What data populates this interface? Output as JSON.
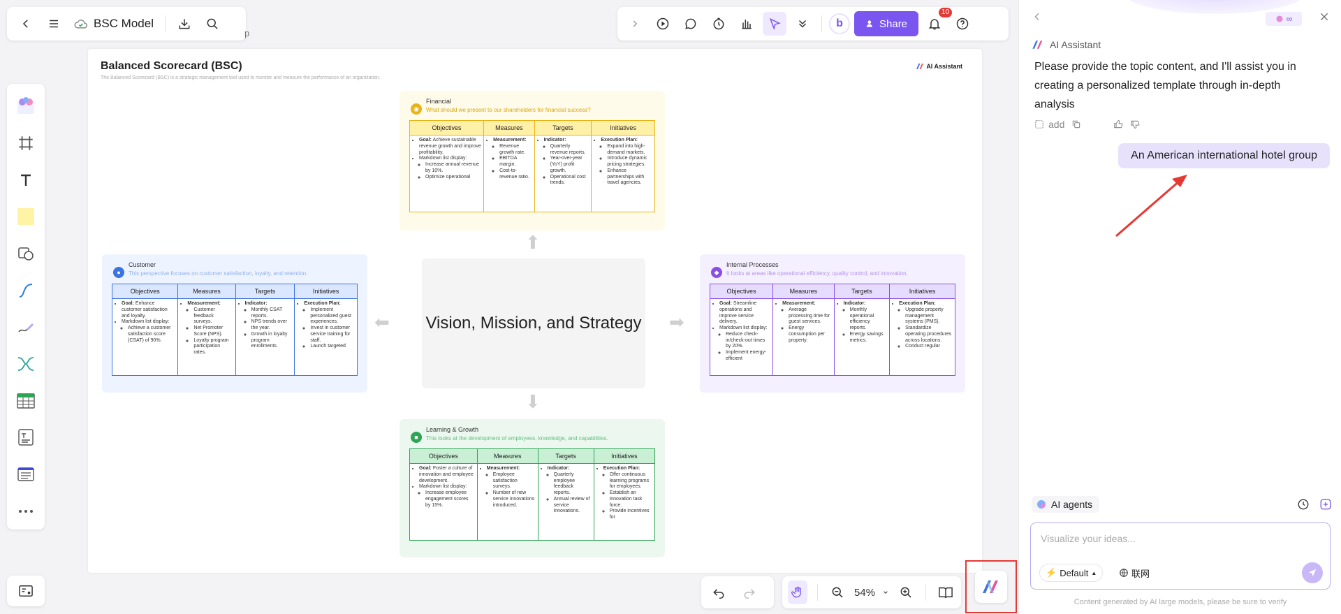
{
  "header": {
    "title": "BSC Model",
    "hidden_text": "p"
  },
  "toolbar": {
    "share_label": "Share",
    "notification_count": "10",
    "avatar_letter": "b"
  },
  "canvas": {
    "title": "Balanced Scorecard (BSC)",
    "subtitle": "The Balanced Scorecard (BSC) is a strategic management tool used to monitor and measure the performance of an organization.",
    "tag": "AI Assistant",
    "center": "Vision, Mission, and Strategy",
    "columns": [
      "Objectives",
      "Measures",
      "Targets",
      "Initiatives"
    ],
    "financial": {
      "title": "Financial",
      "subtitle": "What should we present to our shareholders for financial success?",
      "obj_goal_label": "Goal:",
      "obj_goal": "Achieve sustainable revenue growth and improve profitability.",
      "obj_md": "Markdown list display:",
      "obj_sub1": "Increase annual revenue by 10%.",
      "obj_sub2": "Optimize operational",
      "mea_label": "Measurement:",
      "mea1": "Revenue growth rate.",
      "mea2": "EBITDA margin.",
      "mea3": "Cost-to-revenue ratio.",
      "tar_label": "Indicator:",
      "tar1": "Quarterly revenue reports.",
      "tar2": "Year-over-year (YoY) profit growth.",
      "tar3": "Operational cost trends.",
      "ini_label": "Execution Plan:",
      "ini1": "Expand into high-demand markets.",
      "ini2": "Introduce dynamic pricing strategies.",
      "ini3": "Enhance partnerships with travel agencies."
    },
    "customer": {
      "title": "Customer",
      "subtitle": "This perspective focuses on customer satisfaction, loyalty, and retention.",
      "obj_goal_label": "Goal:",
      "obj_goal": "Enhance customer satisfaction and loyalty.",
      "obj_md": "Markdown list display:",
      "obj_sub1": "Achieve a customer satisfaction score (CSAT) of 90%.",
      "mea_label": "Measurement:",
      "mea1": "Customer feedback surveys.",
      "mea2": "Net Promoter Score (NPS).",
      "mea3": "Loyalty program participation rates.",
      "tar_label": "Indicator:",
      "tar1": "Monthly CSAT reports.",
      "tar2": "NPS trends over the year.",
      "tar3": "Growth in loyalty program enrollments.",
      "ini_label": "Execution Plan:",
      "ini1": "Implement personalized guest experiences.",
      "ini2": "Invest in customer service training for staff.",
      "ini3": "Launch targeted"
    },
    "internal": {
      "title": "Internal Processes",
      "subtitle": "It looks at areas like operational efficiency, quality control, and innovation.",
      "obj_goal_label": "Goal:",
      "obj_goal": "Streamline operations and improve service delivery.",
      "obj_md": "Markdown list display:",
      "obj_sub1": "Reduce check-in/check-out times by 20%.",
      "obj_sub2": "Implement energy-efficient",
      "mea_label": "Measurement:",
      "mea1": "Average processing time for guest services.",
      "mea2": "Energy consumption per property.",
      "tar_label": "Indicator:",
      "tar1": "Monthly operational efficiency reports.",
      "tar2": "Energy savings metrics.",
      "ini_label": "Execution Plan:",
      "ini1": "Upgrade property management systems (PMS).",
      "ini2": "Standardize operating procedures across locations.",
      "ini3": "Conduct regular"
    },
    "learning": {
      "title": "Learning & Growth",
      "subtitle": "This looks at the development of employees, knowledge, and capabilities.",
      "obj_goal_label": "Goal:",
      "obj_goal": "Foster a culture of innovation and employee development.",
      "obj_md": "Markdown list display:",
      "obj_sub1": "Increase employee engagement scores by 15%.",
      "mea_label": "Measurement:",
      "mea1": "Employee satisfaction surveys.",
      "mea2": "Number of new service innovations introduced.",
      "tar_label": "Indicator:",
      "tar1": "Quarterly employee feedback reports.",
      "tar2": "Annual review of service innovations.",
      "ini_label": "Execution Plan:",
      "ini1": "Offer continuous learning programs for employees.",
      "ini2": "Establish an innovation task force.",
      "ini3": "Provide incentives for"
    }
  },
  "bottom": {
    "zoom": "54%"
  },
  "ai_panel": {
    "assistant_name": "AI Assistant",
    "message": "Please provide the topic content, and I'll assist you in creating a personalized template through in-depth analysis",
    "add_label": "add",
    "user_message": "An American international hotel group",
    "agents_label": "AI agents",
    "input_placeholder": "Visualize your ideas...",
    "mode_label": "Default",
    "network_label": "联网",
    "disclaimer": "Content generated by AI large models, please be sure to verify"
  },
  "colors": {
    "accent": "#7b55f0",
    "financial_bg": "#fffbea",
    "financial_accent": "#e7b416",
    "customer_bg": "#eef4ff",
    "customer_accent": "#3b73e0",
    "internal_bg": "#f4f0ff",
    "internal_accent": "#8a4ee6",
    "learning_bg": "#ecf8ef",
    "learning_accent": "#2fa454"
  }
}
